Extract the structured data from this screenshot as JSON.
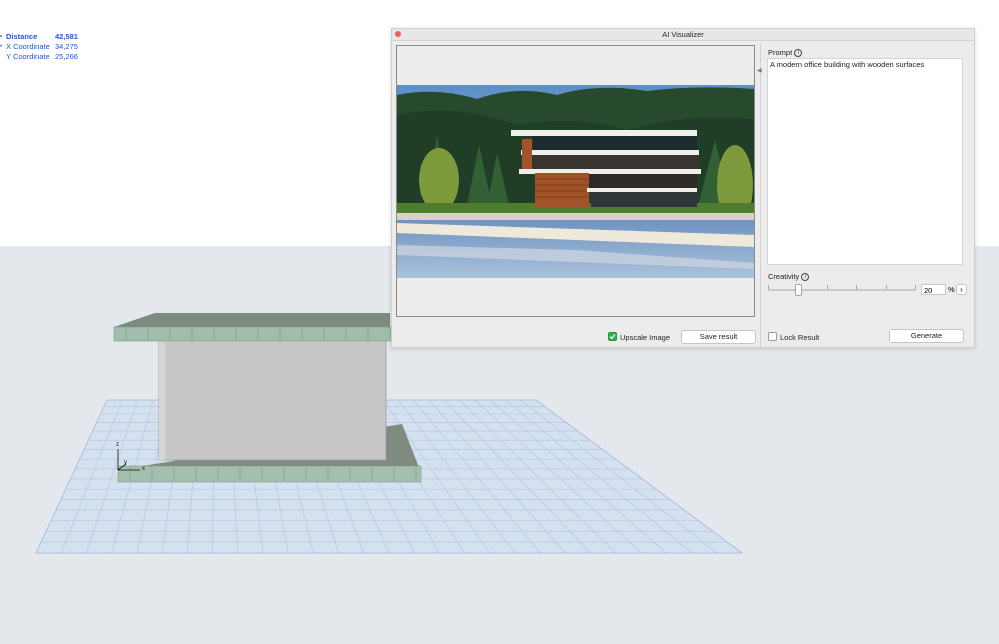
{
  "measurements": [
    {
      "label": "Distance",
      "value": "42,581",
      "bullet": "•",
      "bold": true
    },
    {
      "label": "X Coordinate",
      "value": "34,275",
      "bullet": "•",
      "bold": false
    },
    {
      "label": "Y Coordinate",
      "value": "25,266",
      "bullet": "",
      "bold": false
    }
  ],
  "axes": {
    "z": "z",
    "y": "y",
    "x": "x"
  },
  "window": {
    "title": "AI Visualizer",
    "upscale_label": "Upscale Image",
    "upscale_checked": true,
    "save_label": "Save result",
    "prompt_label": "Prompt",
    "prompt_info": "i",
    "prompt_text": "A modern office building with wooden surfaces",
    "creativity_label": "Creativity",
    "creativity_info": "i",
    "creativity_value": "20",
    "creativity_unit": "%",
    "creativity_level": 0.2,
    "step_glyph": "›",
    "lock_label": "Lock Result",
    "lock_checked": false,
    "generate_label": "Generate"
  },
  "colors": {
    "floor_bg": "#e4e8ec",
    "grid_fill": "#d6e1ef",
    "grid_line": "#a9c3e6",
    "slab_top": "#7d8a80",
    "slab_side": "#9fbcaa",
    "wall": "#c8c8c8",
    "check_on": "#2fb24c",
    "close_button": "#ee5f57"
  }
}
